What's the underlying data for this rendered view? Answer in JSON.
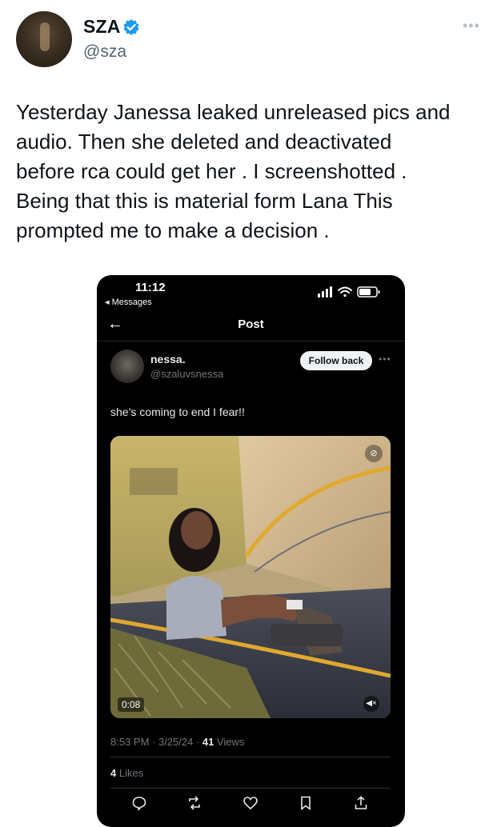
{
  "author": {
    "name": "SZA",
    "handle": "@sza",
    "verified": true,
    "avatar_icon": "profile-photo"
  },
  "tweet": {
    "lines": [
      "Yesterday Janessa leaked unreleased pics and",
      "audio. Then she deleted and deactivated",
      "before rca could get her . I screenshotted .",
      "Being that this is material form Lana This",
      "prompted me to make a decision ."
    ]
  },
  "screenshot": {
    "status": {
      "time": "11:12",
      "back_label": "◂ Messages"
    },
    "nav": {
      "title": "Post"
    },
    "post": {
      "name": "nessa.",
      "handle": "@szaluvsnessa",
      "follow_label": "Follow back",
      "text": "she’s coming to end I fear!!",
      "video_duration": "0:08",
      "timestamp": "8:53 PM · 3/25/24 · ",
      "views_count": "41",
      "views_label": " Views",
      "likes_count": "4",
      "likes_label": " Likes"
    }
  },
  "colors": {
    "verified_blue": "#1d9bf0",
    "text_primary": "#0f1419",
    "text_secondary": "#536471",
    "dark_bg": "#000000"
  }
}
